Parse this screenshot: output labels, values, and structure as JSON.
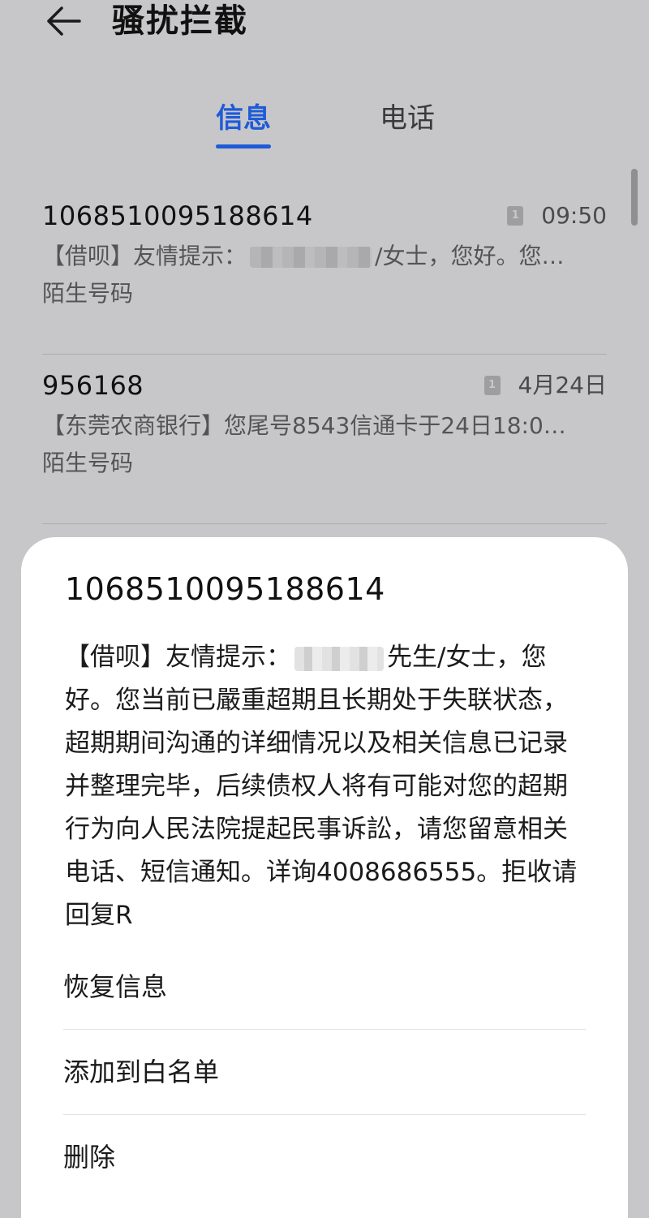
{
  "header": {
    "title": "骚扰拦截"
  },
  "tabs": [
    {
      "label": "信息",
      "active": true
    },
    {
      "label": "电话",
      "active": false
    }
  ],
  "messages": [
    {
      "sender": "1068510095188614",
      "sim_label": "1",
      "time": "09:50",
      "preview_before": "【借呗】友情提示：",
      "preview_after": "/女士，您好。您…",
      "tag": "陌生号码"
    },
    {
      "sender": "956168",
      "sim_label": "1",
      "time": "4月24日",
      "preview_before": "【东莞农商银行】您尾号8543信通卡于24日18:0…",
      "preview_after": "",
      "tag": "陌生号码"
    }
  ],
  "detail_sheet": {
    "sender": "1068510095188614",
    "body_before": "【借呗】友情提示：",
    "body_after": "先生/女士，您好。您当前已嚴重超期且长期处于失联状态，超期期间沟通的详细情况以及相关信息已记录并整理完毕，后续债权人将有可能对您的超期行为向人民法院提起民事诉訟，请您留意相关电话、短信通知。详询4008686555。拒收请回复R",
    "actions": [
      {
        "label": "恢复信息"
      },
      {
        "label": "添加到白名单"
      },
      {
        "label": "删除"
      }
    ]
  },
  "colors": {
    "background": "#c7c7c9",
    "accent": "#1f5bd8",
    "sheet": "#ffffff"
  },
  "icons": {
    "back": "back-arrow-icon",
    "sim": "sim-card-icon"
  }
}
